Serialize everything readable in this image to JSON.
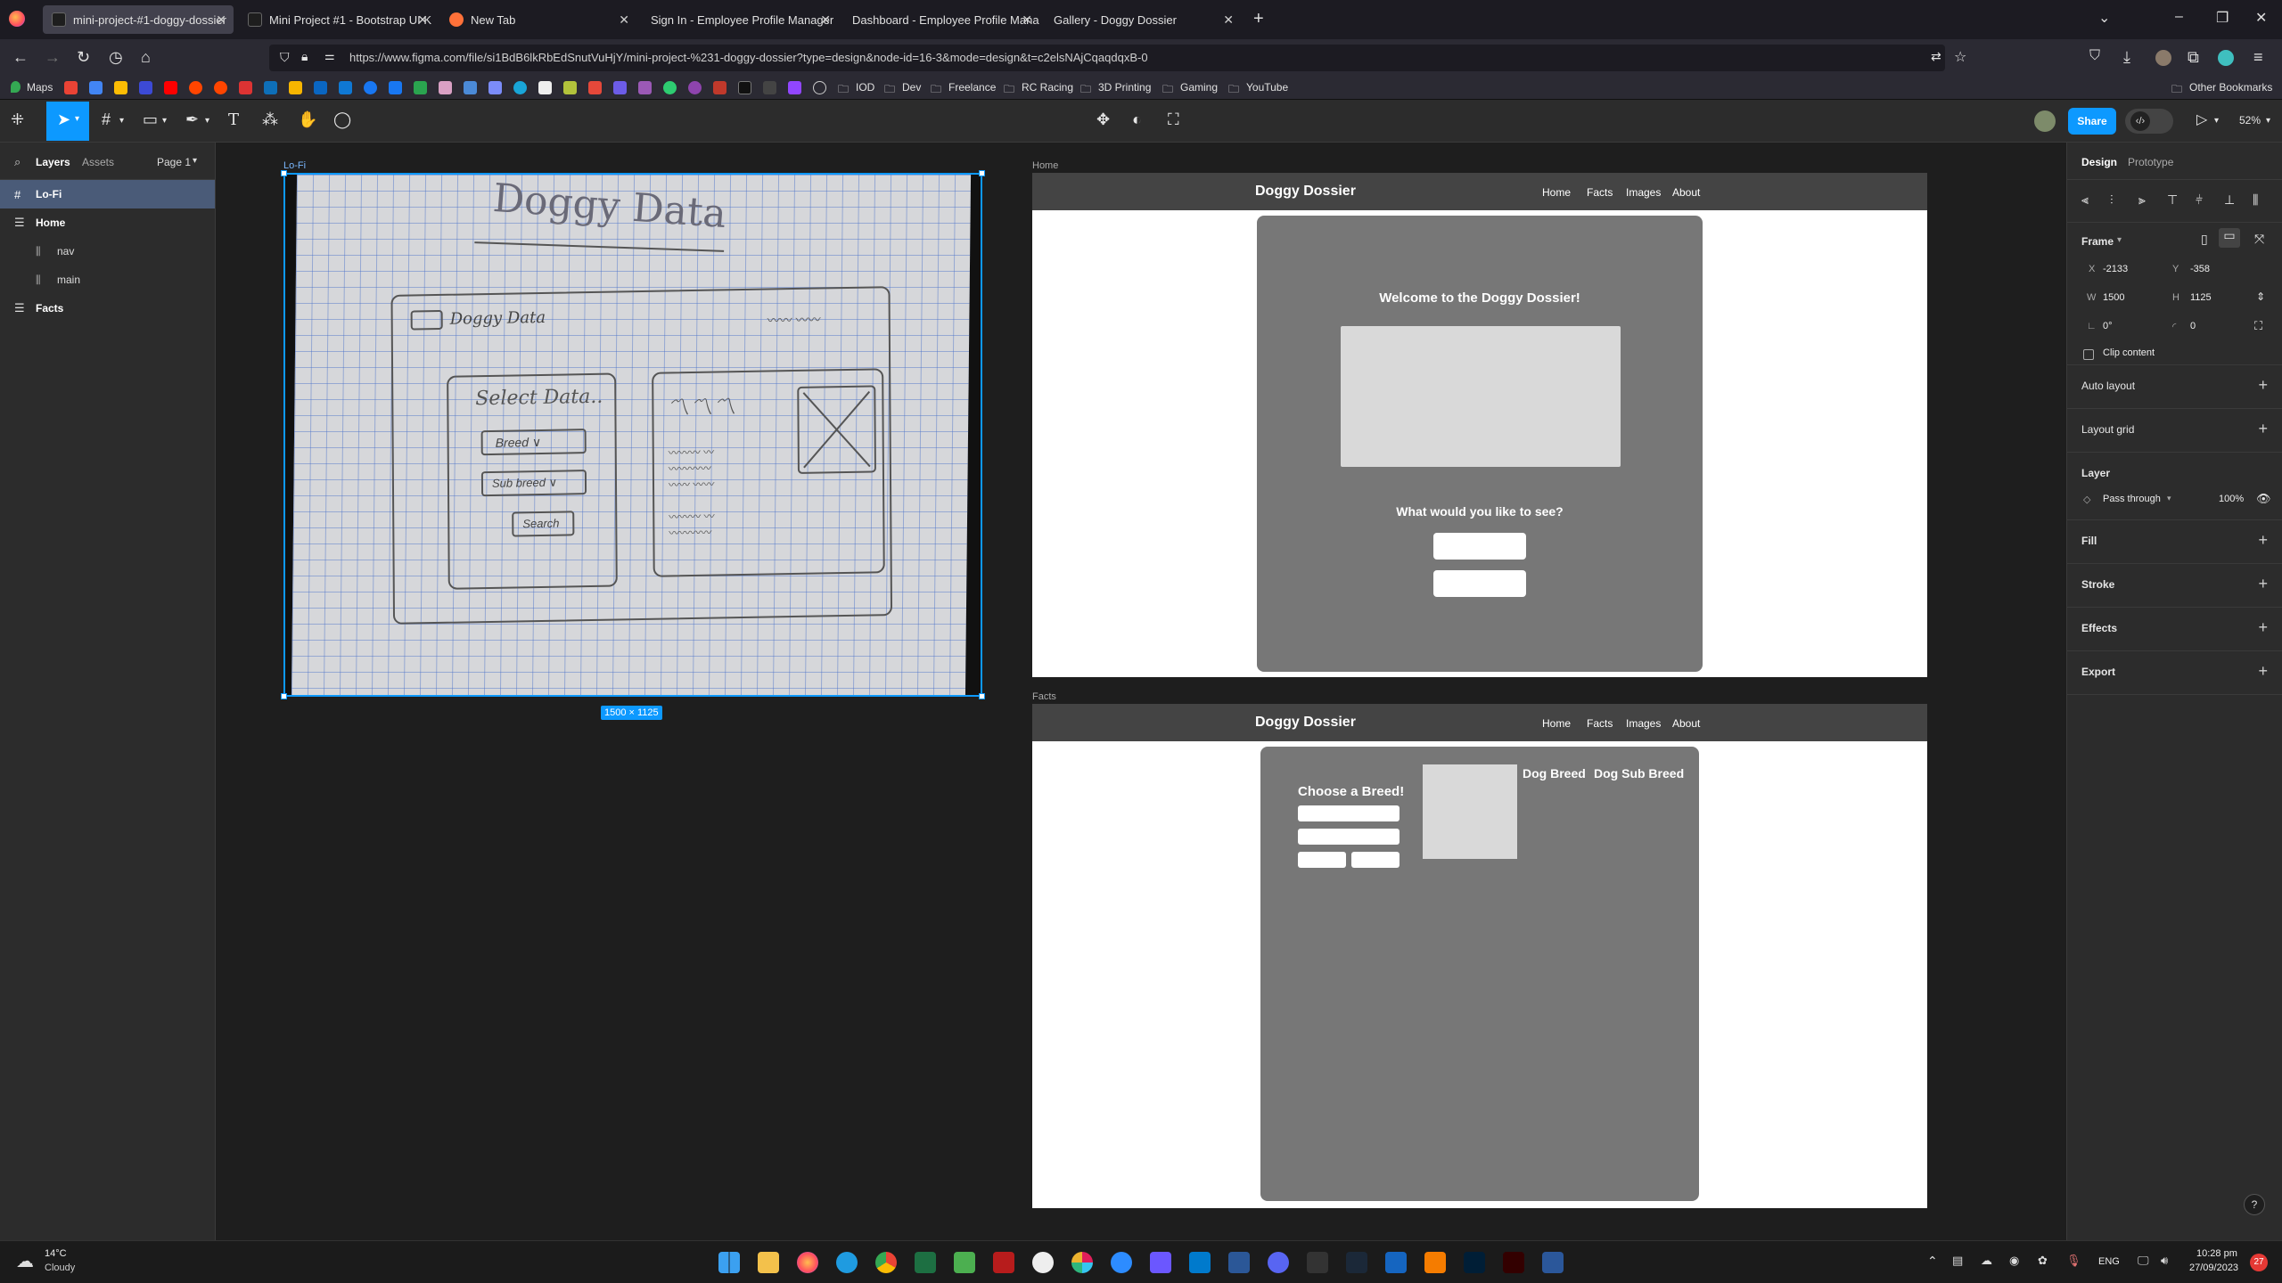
{
  "browser": {
    "tabs": [
      {
        "title": "mini-project-#1-doggy-dossier",
        "active": true,
        "favicon_color": "#1e1e1e"
      },
      {
        "title": "Mini Project #1 - Bootstrap UI K",
        "active": false,
        "favicon_color": "#1e1e1e"
      },
      {
        "title": "New Tab",
        "active": false,
        "favicon_color": "#ff7139"
      },
      {
        "title": "Sign In - Employee Profile Manager",
        "active": false,
        "favicon_color": ""
      },
      {
        "title": "Dashboard - Employee Profile Mana",
        "active": false,
        "favicon_color": ""
      },
      {
        "title": "Gallery - Doggy Dossier",
        "active": false,
        "favicon_color": ""
      }
    ],
    "url": "https://www.figma.com/file/si1BdB6lkRbEdSnutVuHjY/mini-project-%231-doggy-dossier?type=design&node-id=16-3&mode=design&t=c2elsNAjCqaqdqxB-0",
    "bookmarks": [
      "Maps",
      "IOD",
      "Dev",
      "Freelance",
      "RC Racing",
      "3D Printing",
      "Gaming",
      "YouTube"
    ],
    "other_bookmarks": "Other Bookmarks"
  },
  "figma": {
    "share_label": "Share",
    "zoom": "52%",
    "left_tabs": {
      "layers": "Layers",
      "assets": "Assets",
      "page": "Page 1"
    },
    "layers": [
      {
        "name": "Lo-Fi",
        "selected": true,
        "indent": 0,
        "icon": "frame-icon"
      },
      {
        "name": "Home",
        "selected": false,
        "indent": 0,
        "icon": "frame-icon"
      },
      {
        "name": "nav",
        "selected": false,
        "indent": 1,
        "icon": "autolayout-icon"
      },
      {
        "name": "main",
        "selected": false,
        "indent": 1,
        "icon": "autolayout-icon"
      },
      {
        "name": "Facts",
        "selected": false,
        "indent": 0,
        "icon": "frame-icon"
      }
    ],
    "right_tabs": {
      "design": "Design",
      "prototype": "Prototype"
    },
    "frame": {
      "label": "Frame",
      "x_label": "X",
      "x": "-2133",
      "y_label": "Y",
      "y": "-358",
      "w_label": "W",
      "w": "1500",
      "h_label": "H",
      "h": "1125",
      "rotation": "0°",
      "radius": "0",
      "clip_label": "Clip content"
    },
    "sections": {
      "auto_layout": "Auto layout",
      "layout_grid": "Layout grid",
      "layer": "Layer",
      "fill": "Fill",
      "stroke": "Stroke",
      "effects": "Effects",
      "export": "Export"
    },
    "layer_props": {
      "blend": "Pass through",
      "opacity": "100%"
    },
    "help": "?"
  },
  "canvas": {
    "lofi": {
      "label": "Lo-Fi",
      "size_badge": "1500 × 1125",
      "sketch": {
        "title": "Doggy Data",
        "brand": "Doggy Data",
        "select_heading": "Select Data..",
        "breed": "Breed",
        "sub_breed": "Sub breed",
        "search": "Search"
      }
    },
    "home": {
      "label": "Home",
      "brand": "Doggy Dossier",
      "nav": [
        "Home",
        "Facts",
        "Images",
        "About"
      ],
      "welcome": "Welcome to the Doggy Dossier!",
      "question": "What would you like to see?"
    },
    "facts": {
      "label": "Facts",
      "brand": "Doggy Dossier",
      "nav": [
        "Home",
        "Facts",
        "Images",
        "About"
      ],
      "choose": "Choose a Breed!",
      "breed_heading": "Dog Breed",
      "sub_breed_heading": "Dog Sub Breed"
    }
  },
  "taskbar": {
    "weather_temp": "14°C",
    "weather_desc": "Cloudy",
    "lang": "ENG",
    "time": "10:28 pm",
    "date": "27/09/2023",
    "notifications": "27"
  }
}
